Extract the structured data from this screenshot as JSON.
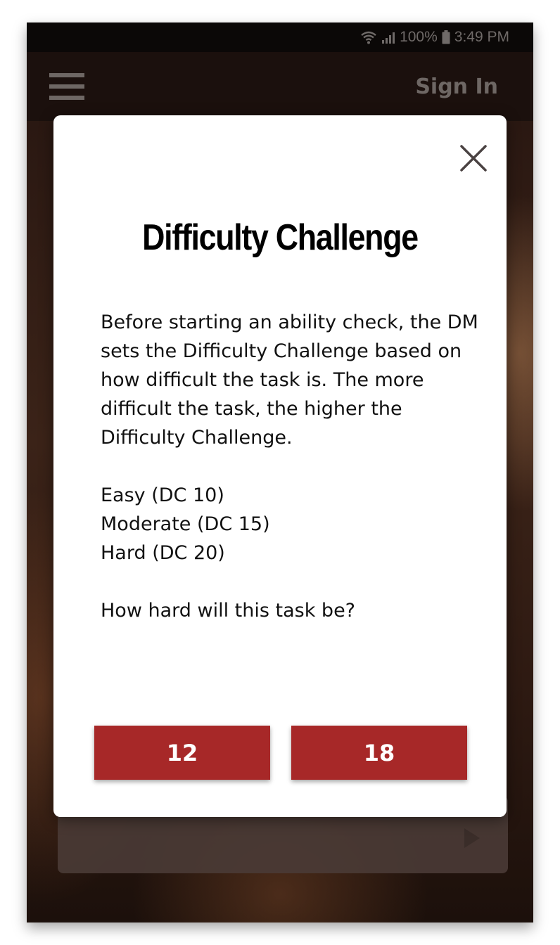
{
  "status_bar": {
    "battery": "100%",
    "time": "3:49 PM",
    "wifi_icon": "wifi-icon",
    "signal_icon": "signal-icon",
    "battery_icon": "battery-icon"
  },
  "app_bar": {
    "menu_icon": "hamburger-menu-icon",
    "sign_in_label": "Sign In"
  },
  "modal": {
    "close_icon": "close-icon",
    "title": "Difficulty Challenge",
    "paragraph": "Before starting an ability check, the DM sets the Difficulty Challenge based on how difficult the task is. The more difficult the task, the higher the Difficulty Challenge.",
    "levels": [
      "Easy (DC 10)",
      "Moderate (DC 15)",
      "Hard (DC 20)"
    ],
    "question": "How hard will this task be?",
    "options": [
      "12",
      "18"
    ]
  },
  "colors": {
    "accent": "#a72828",
    "modal_bg": "#ffffff",
    "app_bar_bg": "#1b100d",
    "status_bar_bg": "#0b0807"
  },
  "background_card": {
    "play_icon": "play-icon"
  }
}
